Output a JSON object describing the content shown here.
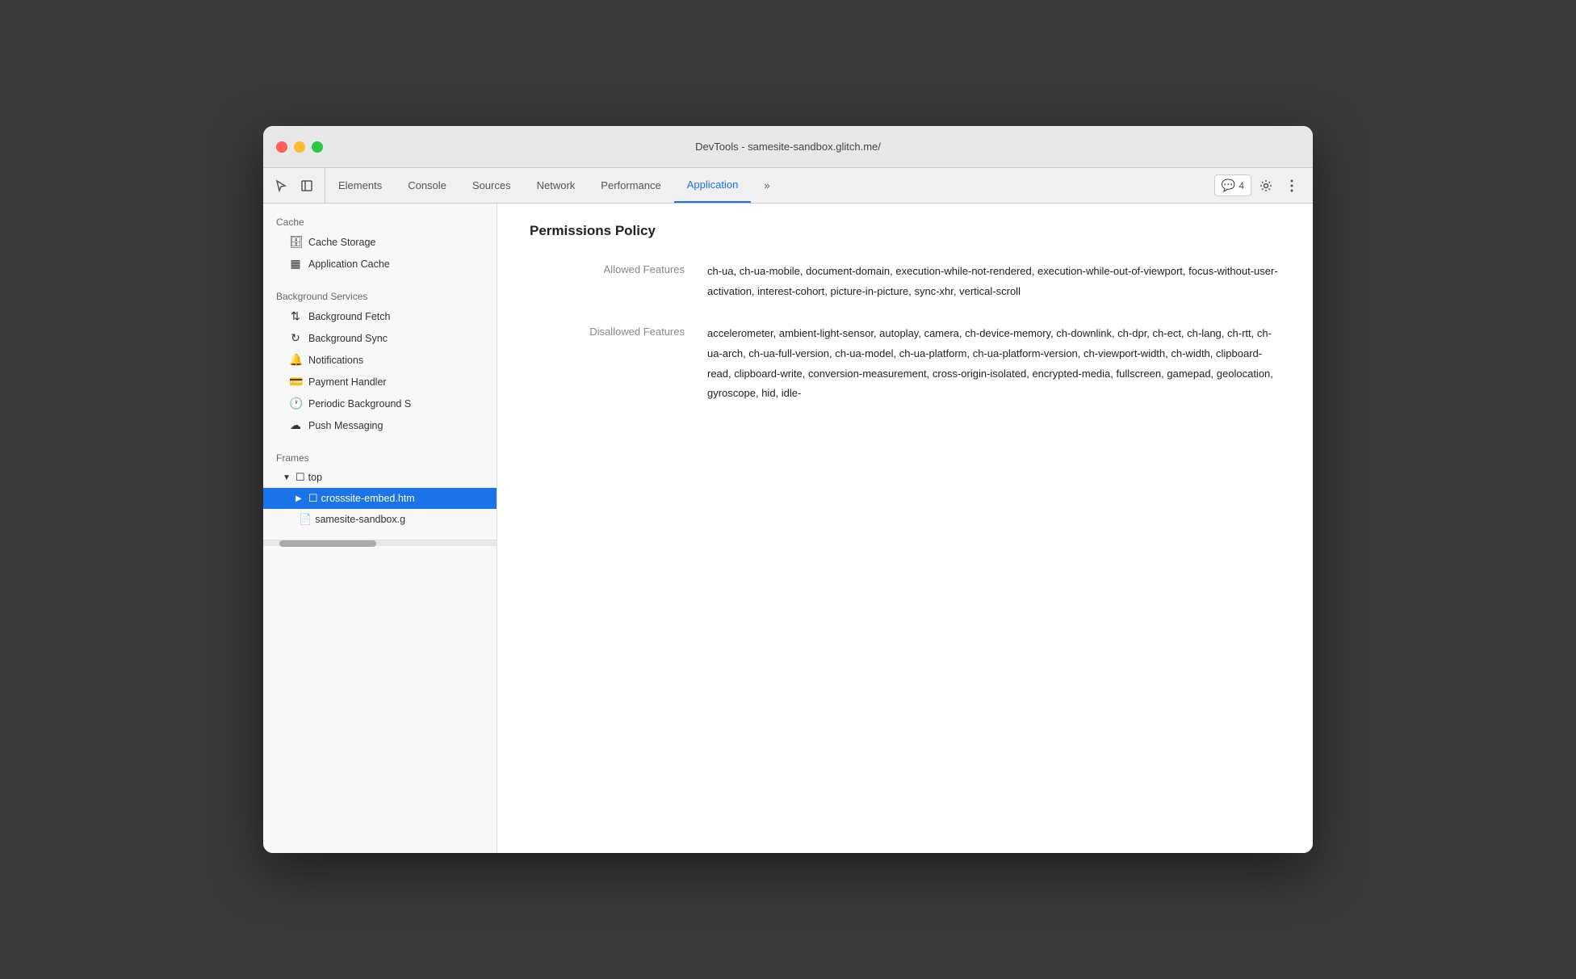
{
  "window": {
    "title": "DevTools - samesite-sandbox.glitch.me/"
  },
  "toolbar": {
    "tabs": [
      {
        "id": "elements",
        "label": "Elements",
        "active": false
      },
      {
        "id": "console",
        "label": "Console",
        "active": false
      },
      {
        "id": "sources",
        "label": "Sources",
        "active": false
      },
      {
        "id": "network",
        "label": "Network",
        "active": false
      },
      {
        "id": "performance",
        "label": "Performance",
        "active": false
      },
      {
        "id": "application",
        "label": "Application",
        "active": true
      },
      {
        "id": "more",
        "label": "»",
        "active": false
      }
    ],
    "badge_count": "4",
    "badge_icon": "💬"
  },
  "sidebar": {
    "cache_section": "Cache",
    "cache_storage_label": "Cache Storage",
    "application_cache_label": "Application Cache",
    "bg_services_section": "Background Services",
    "bg_fetch_label": "Background Fetch",
    "bg_sync_label": "Background Sync",
    "notifications_label": "Notifications",
    "payment_handler_label": "Payment Handler",
    "periodic_bg_label": "Periodic Background S",
    "push_messaging_label": "Push Messaging",
    "frames_section": "Frames",
    "frame_top": "top",
    "frame_crosssite": "crosssite-embed.htm",
    "frame_samesite": "samesite-sandbox.g"
  },
  "content": {
    "title": "Permissions Policy",
    "allowed_label": "Allowed Features",
    "allowed_value": "ch-ua, ch-ua-mobile, document-domain, execution-while-not-rendered, execution-while-out-of-viewport, focus-without-user-activation, interest-cohort, picture-in-picture, sync-xhr, vertical-scroll",
    "disallowed_label": "Disallowed Features",
    "disallowed_value": "accelerometer, ambient-light-sensor, autoplay, camera, ch-device-memory, ch-downlink, ch-dpr, ch-ect, ch-lang, ch-rtt, ch-ua-arch, ch-ua-full-version, ch-ua-model, ch-ua-platform, ch-ua-platform-version, ch-viewport-width, ch-width, clipboard-read, clipboard-write, conversion-measurement, cross-origin-isolated, encrypted-media, fullscreen, gamepad, geolocation, gyroscope, hid, idle-"
  }
}
